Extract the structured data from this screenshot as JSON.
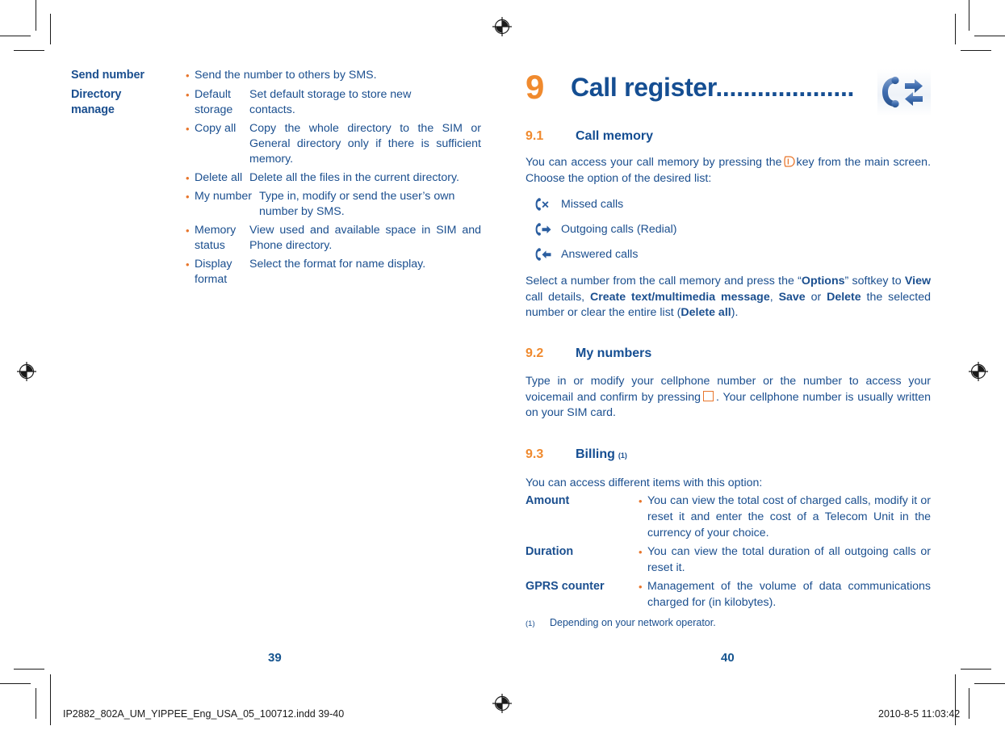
{
  "document": {
    "left_page_number": "39",
    "right_page_number": "40"
  },
  "colors": {
    "blue": "#154e92",
    "orange": "#f08a2e",
    "bullet_orange": "#e8762c"
  },
  "left_column": {
    "rows": [
      {
        "term": "Send number",
        "items": [
          {
            "bullet": "•",
            "label": "",
            "desc": "Send the number to others by SMS."
          }
        ]
      },
      {
        "term": "Directory manage",
        "term_line1": "Directory",
        "term_line2": "manage",
        "items": [
          {
            "bullet": "•",
            "label": "Default storage",
            "desc": "Set default storage to store new contacts."
          },
          {
            "bullet": "•",
            "label": "Copy all",
            "desc": "Copy the whole directory to the SIM or General directory only if there is sufficient memory."
          },
          {
            "bullet": "•",
            "label": "Delete all",
            "desc": "Delete all the files in the current directory."
          },
          {
            "bullet": "•",
            "label": "My number",
            "desc": "Type in, modify or send the user's own number by SMS."
          },
          {
            "bullet": "•",
            "label": "Memory status",
            "desc": "View used and available space in SIM and Phone directory."
          },
          {
            "bullet": "•",
            "label": "Display format",
            "desc": "Select the format for name display."
          }
        ]
      }
    ]
  },
  "right_column": {
    "chapter": {
      "number": "9",
      "title": "Call register",
      "leader": "....................",
      "icon": "call-register-icon"
    },
    "section_9_1": {
      "number": "9.1",
      "title": "Call memory",
      "intro_before_key": "You can access your call memory by pressing the",
      "intro_after_key": "key from the main screen. Choose the option of the desired list:",
      "call_list": [
        {
          "icon": "missed-call-icon",
          "label": "Missed calls"
        },
        {
          "icon": "outgoing-call-icon",
          "label": "Outgoing calls (Redial)"
        },
        {
          "icon": "answered-call-icon",
          "label": "Answered calls"
        }
      ],
      "options_paragraph": {
        "p1": "Select a number from the call memory and press the “",
        "b1": "Options",
        "p2": "” softkey to ",
        "b2": "View",
        "p3": " call details, ",
        "b3": "Create text/multimedia message",
        "p4": ", ",
        "b4": "Save",
        "p5": " or ",
        "b5": "Delete",
        "p6": " the selected number or clear the entire list (",
        "b6": "Delete all",
        "p7": ")."
      }
    },
    "section_9_2": {
      "number": "9.2",
      "title": "My numbers",
      "text_before_key": "Type in or modify your cellphone number or the number to access your voicemail and confirm by pressing",
      "text_after_key": ". Your cellphone number is usually written on your SIM card."
    },
    "section_9_3": {
      "number": "9.3",
      "title": "Billing",
      "footnote_marker": "(1)",
      "intro": "You can access different items with this option:",
      "rows": [
        {
          "term": "Amount",
          "bullet": "•",
          "desc": "You can view the total cost of charged calls, modify it or reset it and enter the cost of a Telecom Unit in the currency of your choice."
        },
        {
          "term": "Duration",
          "bullet": "•",
          "desc": "You can view the total duration of all outgoing calls or reset it."
        },
        {
          "term": "GPRS counter",
          "bullet": "•",
          "desc": "Management of the volume of data communications charged for (in kilobytes)."
        }
      ],
      "footnote": {
        "marker": "(1)",
        "text": "Depending on your network operator."
      }
    }
  },
  "print_footer": {
    "filename": "IP2882_802A_UM_YIPPEE_Eng_USA_05_100712.indd   39-40",
    "timestamp": "2010-8-5   11:03:42"
  }
}
